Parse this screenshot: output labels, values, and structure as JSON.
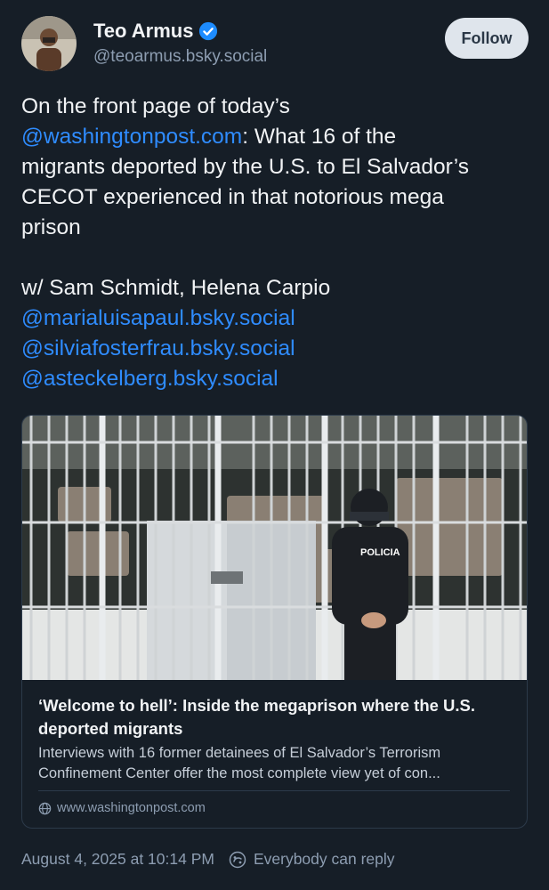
{
  "author": {
    "display_name": "Teo Armus",
    "handle": "@teoarmus.bsky.social",
    "verified": true
  },
  "follow_label": "Follow",
  "post": {
    "line1": "On the front page of today’s",
    "link_wapo": "@washingtonpost.com",
    "line2_rest": ": What 16 of the",
    "line3": "migrants deported by the U.S. to El Salvador’s",
    "line4": "CECOT experienced in that notorious mega",
    "line5": "prison",
    "line6": "w/ Sam Schmidt, Helena Carpio",
    "mention1": "@marialuisapaul.bsky.social",
    "mention2": "@silviafosterfrau.bsky.social",
    "mention3": "@asteckelberg.bsky.social"
  },
  "link_card": {
    "image_label": "POLICIA",
    "title": "‘Welcome to hell’: Inside the megaprison where the U.S. deported migrants",
    "desc_line1": "Interviews with 16 former detainees of El Salvador’s Terrorism",
    "desc_line2": "Confinement Center offer the most complete view yet of con...",
    "domain": "www.washingtonpost.com"
  },
  "footer": {
    "timestamp": "August 4, 2025 at 10:14 PM",
    "reply_setting": "Everybody can reply"
  },
  "colors": {
    "background": "#161e27",
    "link": "#2f8cff",
    "muted": "#8d9db1",
    "verified": "#1d8cff"
  },
  "icons": [
    "verified-badge-icon",
    "globe-icon",
    "reply-settings-icon"
  ]
}
